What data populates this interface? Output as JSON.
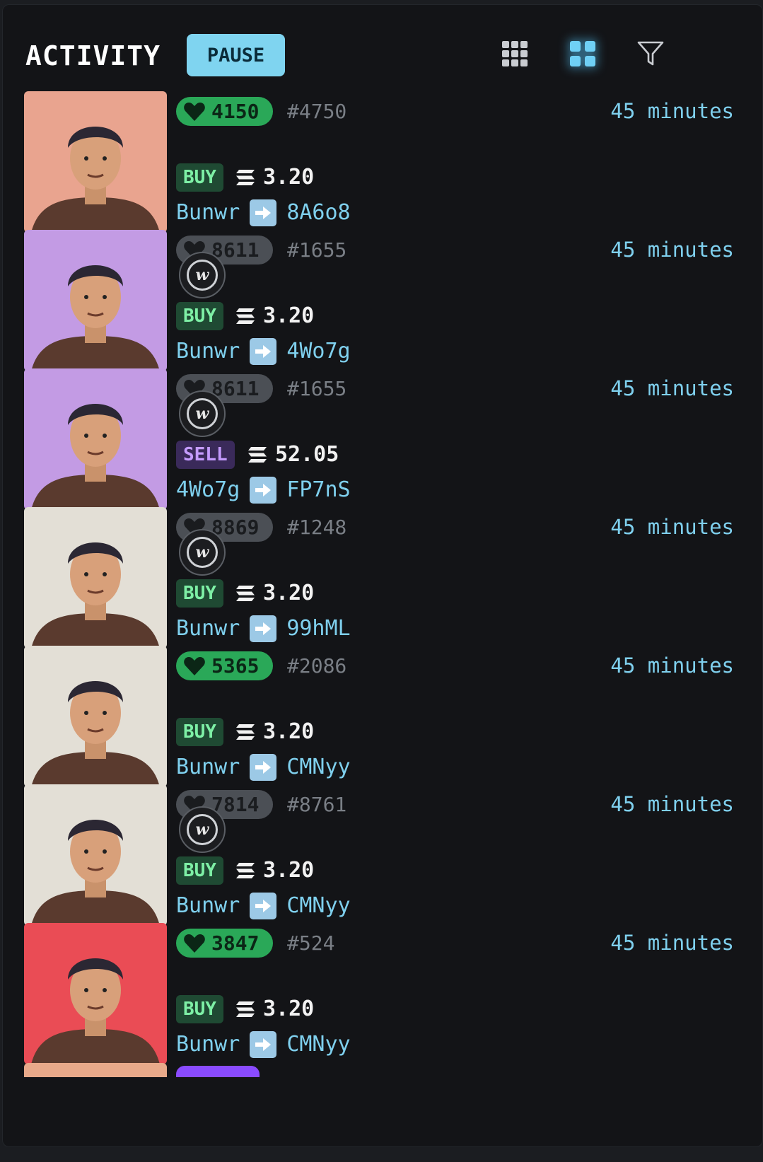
{
  "header": {
    "title": "ACTIVITY",
    "pause_label": "PAUSE",
    "icons": [
      "grid-small-icon",
      "grid-large-icon",
      "filter-icon"
    ]
  },
  "colors": {
    "accent": "#7fd4f0",
    "rarity_green": "#2aa858",
    "rarity_gray": "#4b4f55",
    "buy": "#7ef0a6",
    "sell": "#c49bff"
  },
  "rows": [
    {
      "rarity": "4150",
      "rarity_style": "green",
      "has_coin": false,
      "rank": "#4750",
      "time": "45 minutes",
      "type": "BUY",
      "price": "3.20",
      "from": "Bunwr",
      "to": "8A6o8",
      "thumb": "salmon"
    },
    {
      "rarity": "8611",
      "rarity_style": "gray",
      "has_coin": true,
      "rank": "#1655",
      "time": "45 minutes",
      "type": "BUY",
      "price": "3.20",
      "from": "Bunwr",
      "to": "4Wo7g",
      "thumb": "purple"
    },
    {
      "rarity": "8611",
      "rarity_style": "gray",
      "has_coin": true,
      "rank": "#1655",
      "time": "45 minutes",
      "type": "SELL",
      "price": "52.05",
      "from": "4Wo7g",
      "to": "FP7nS",
      "thumb": "purple"
    },
    {
      "rarity": "8869",
      "rarity_style": "gray",
      "has_coin": true,
      "rank": "#1248",
      "time": "45 minutes",
      "type": "BUY",
      "price": "3.20",
      "from": "Bunwr",
      "to": "99hML",
      "thumb": "cream"
    },
    {
      "rarity": "5365",
      "rarity_style": "green",
      "has_coin": false,
      "rank": "#2086",
      "time": "45 minutes",
      "type": "BUY",
      "price": "3.20",
      "from": "Bunwr",
      "to": "CMNyy",
      "thumb": "cream"
    },
    {
      "rarity": "7814",
      "rarity_style": "gray",
      "has_coin": true,
      "rank": "#8761",
      "time": "45 minutes",
      "type": "BUY",
      "price": "3.20",
      "from": "Bunwr",
      "to": "CMNyy",
      "thumb": "cream"
    },
    {
      "rarity": "3847",
      "rarity_style": "green",
      "has_coin": false,
      "rank": "#524",
      "time": "45 minutes",
      "type": "BUY",
      "price": "3.20",
      "from": "Bunwr",
      "to": "CMNyy",
      "thumb": "red"
    }
  ]
}
